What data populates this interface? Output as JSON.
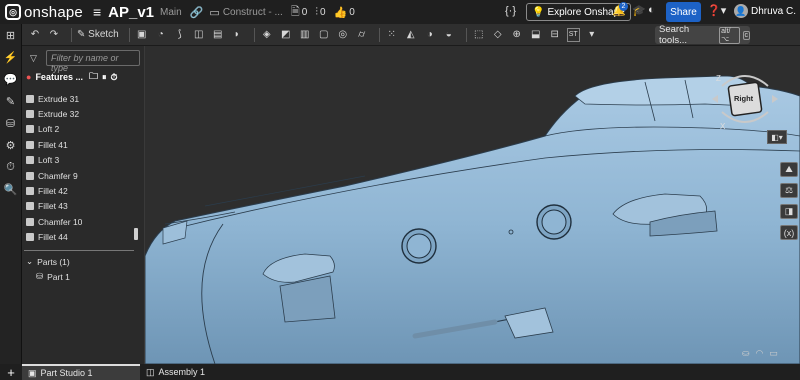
{
  "topbar": {
    "brand": "onshape",
    "doc_title": "AP_v1",
    "branch": "Main",
    "breadcrumb": "Construct - ...",
    "comment_count": "0",
    "version_count": "0",
    "like_count": "0",
    "explore_label": "Explore Onshape",
    "notif_badge": "2",
    "share_label": "Share",
    "user_name": "Dhruva C."
  },
  "toolbar": {
    "sketch_label": "Sketch",
    "search_label": "Search tools...",
    "search_kbd_1": "alt/⌥",
    "search_kbd_2": "c",
    "st_label": "ST"
  },
  "feature_panel": {
    "filter_placeholder": "Filter by name or type",
    "header_label": "Features ...",
    "items": [
      {
        "label": "Extrude 31"
      },
      {
        "label": "Extrude 32"
      },
      {
        "label": "Loft 2"
      },
      {
        "label": "Fillet 41"
      },
      {
        "label": "Loft 3"
      },
      {
        "label": "Chamfer 9"
      },
      {
        "label": "Fillet 42"
      },
      {
        "label": "Fillet 43"
      },
      {
        "label": "Chamfer 10"
      },
      {
        "label": "Fillet 44"
      }
    ],
    "parts_label": "Parts (1)",
    "part_label": "Part 1"
  },
  "viewcube": {
    "face_label": "Right",
    "axis_z": "Z",
    "axis_x": "X"
  },
  "tabs": [
    {
      "label": "Part Studio 1",
      "active": true
    },
    {
      "label": "Assembly 1",
      "active": false
    }
  ],
  "colors": {
    "part": "#8fb5d3",
    "accent": "#1d62c6",
    "background": "#2e2e2e"
  }
}
